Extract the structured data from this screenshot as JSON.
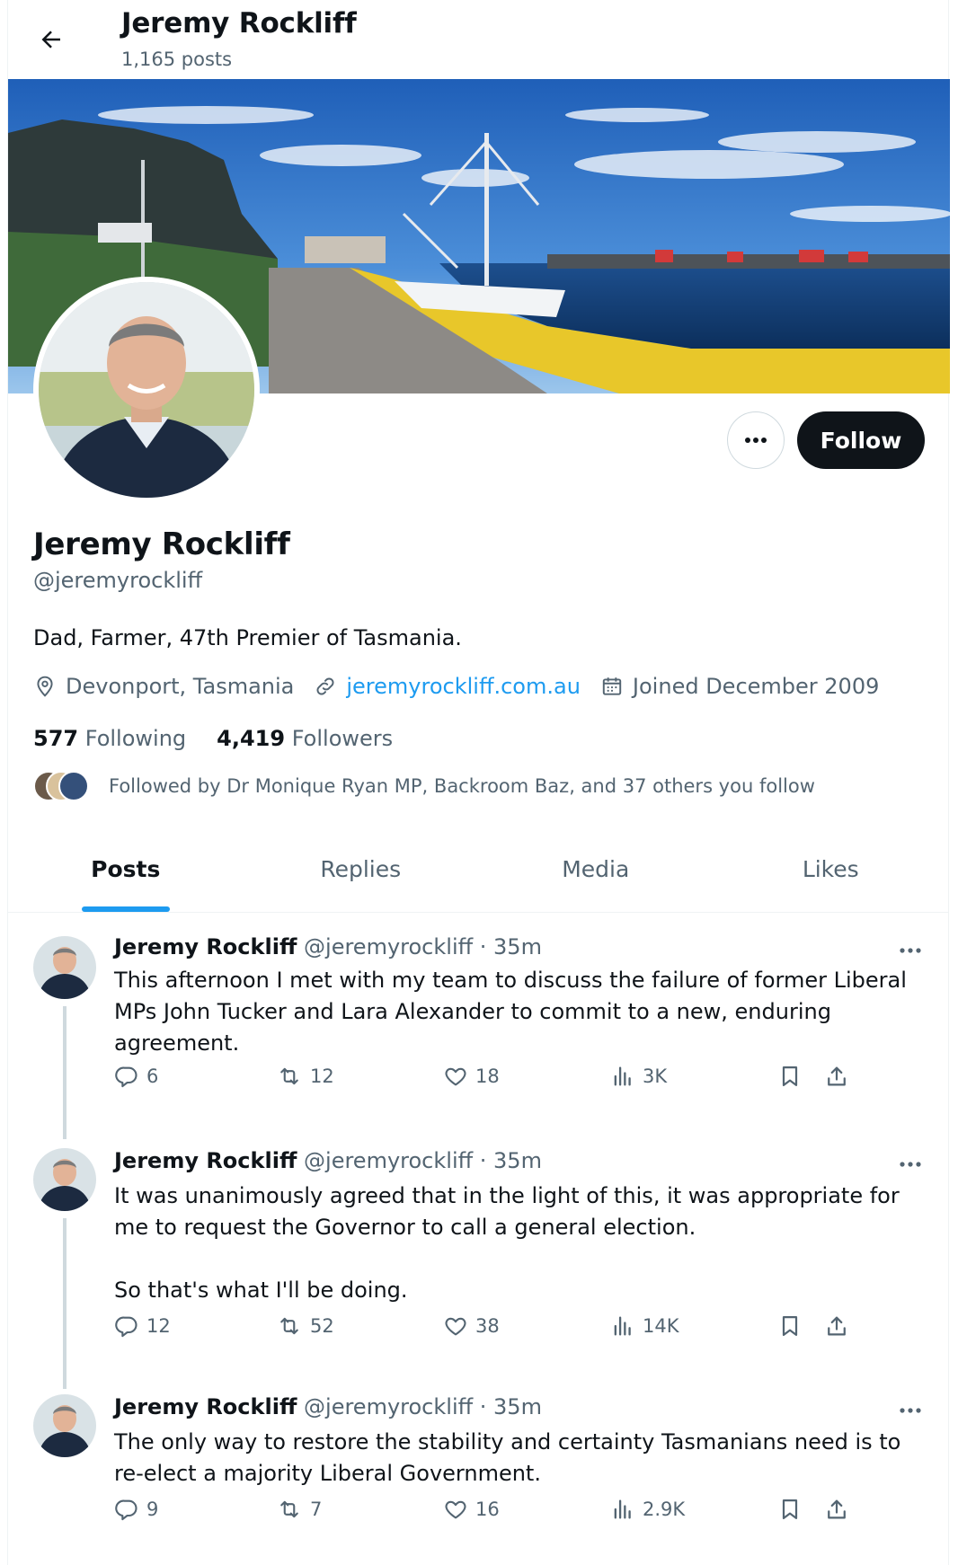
{
  "header": {
    "title": "Jeremy Rockliff",
    "post_count": "1,165 posts"
  },
  "profile": {
    "name": "Jeremy Rockliff",
    "handle": "@jeremyrockliff",
    "bio": "Dad, Farmer, 47th Premier of Tasmania.",
    "location": "Devonport, Tasmania",
    "website": "jeremyrockliff.com.au",
    "joined": "Joined December 2009",
    "following_count": "577",
    "following_label": "Following",
    "followers_count": "4,419",
    "followers_label": "Followers",
    "followed_by": "Followed by Dr Monique Ryan MP, Backroom Baz, and 37 others you follow",
    "follow_label": "Follow",
    "more_icon": "ellipsis-icon"
  },
  "tabs": [
    {
      "label": "Posts",
      "active": true
    },
    {
      "label": "Replies",
      "active": false
    },
    {
      "label": "Media",
      "active": false
    },
    {
      "label": "Likes",
      "active": false
    }
  ],
  "tweets": [
    {
      "name": "Jeremy Rockliff",
      "handle": "@jeremyrockliff",
      "time": "· 35m",
      "text": "This afternoon I met with my team to discuss the failure of former Liberal MPs John Tucker and Lara Alexander to commit to a new, enduring agreement.",
      "replies": "6",
      "reposts": "12",
      "likes": "18",
      "views": "3K"
    },
    {
      "name": "Jeremy Rockliff",
      "handle": "@jeremyrockliff",
      "time": "· 35m",
      "text": "It was unanimously agreed that in the light of this, it was appropriate for me to request the Governor to call a general election.\n\nSo that's what I'll be doing.",
      "replies": "12",
      "reposts": "52",
      "likes": "38",
      "views": "14K"
    },
    {
      "name": "Jeremy Rockliff",
      "handle": "@jeremyrockliff",
      "time": "· 35m",
      "text": "The only way to restore the stability and certainty Tasmanians need is to re-elect a majority Liberal Government.",
      "replies": "9",
      "reposts": "7",
      "likes": "16",
      "views": "2.9K"
    }
  ],
  "colors": {
    "accent": "#1d9bf0",
    "text_primary": "#0f1419",
    "text_secondary": "#536471",
    "follow_button": "#0f1419"
  }
}
